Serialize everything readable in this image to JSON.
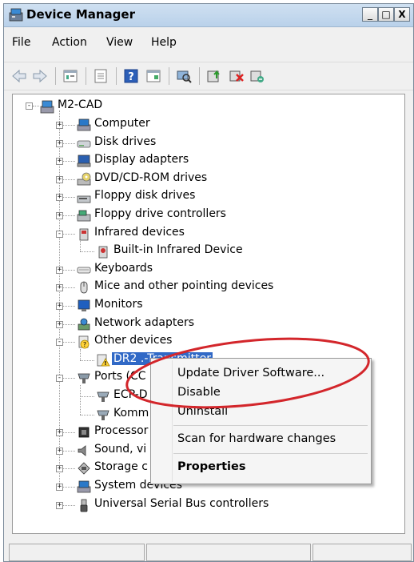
{
  "window": {
    "title": "Device Manager",
    "controls": {
      "minimize": "_",
      "maximize": "□",
      "close": "X"
    }
  },
  "menu": [
    "File",
    "Action",
    "View",
    "Help"
  ],
  "toolbar": {
    "icons": [
      "back-icon",
      "forward-icon",
      "tree-view-icon",
      "properties-icon",
      "help-icon",
      "action-view-icon",
      "scan-hardware-icon",
      "update-driver-icon",
      "disable-icon",
      "uninstall-icon"
    ]
  },
  "tree": {
    "root": "M2-CAD",
    "nodes": [
      {
        "label": "Computer",
        "icon": "computer-icon",
        "expander": "+"
      },
      {
        "label": "Disk drives",
        "icon": "disk-drive-icon",
        "expander": "+"
      },
      {
        "label": "Display adapters",
        "icon": "display-adapter-icon",
        "expander": "+"
      },
      {
        "label": "DVD/CD-ROM drives",
        "icon": "dvd-drive-icon",
        "expander": "+"
      },
      {
        "label": "Floppy disk drives",
        "icon": "floppy-drive-icon",
        "expander": "+"
      },
      {
        "label": "Floppy drive controllers",
        "icon": "floppy-controller-icon",
        "expander": "+"
      },
      {
        "label": "Infrared devices",
        "icon": "infrared-icon",
        "expander": "-"
      },
      {
        "label": "Built-in Infrared Device",
        "icon": "infrared-device-icon",
        "expander": ""
      },
      {
        "label": "Keyboards",
        "icon": "keyboard-icon",
        "expander": "+"
      },
      {
        "label": "Mice and other pointing devices",
        "icon": "mouse-icon",
        "expander": "+"
      },
      {
        "label": "Monitors",
        "icon": "monitor-icon",
        "expander": "+"
      },
      {
        "label": "Network adapters",
        "icon": "network-adapter-icon",
        "expander": "+"
      },
      {
        "label": "Other devices",
        "icon": "other-devices-icon",
        "expander": "-"
      },
      {
        "label": "DR2 .-Transmitter",
        "icon": "warning-device-icon",
        "expander": ""
      },
      {
        "label": "Ports (CC",
        "icon": "port-icon",
        "expander": "-"
      },
      {
        "label": "ECP-D",
        "icon": "port-device-icon",
        "expander": ""
      },
      {
        "label": "Komm",
        "icon": "port-device-icon",
        "expander": ""
      },
      {
        "label": "Processor",
        "icon": "processor-icon",
        "expander": "+"
      },
      {
        "label": "Sound, vi",
        "icon": "sound-icon",
        "expander": "+"
      },
      {
        "label": "Storage c",
        "icon": "storage-icon",
        "expander": "+"
      },
      {
        "label": "System devices",
        "icon": "system-devices-icon",
        "expander": "+"
      },
      {
        "label": "Universal Serial Bus controllers",
        "icon": "usb-icon",
        "expander": "+"
      }
    ]
  },
  "context_menu": {
    "items": [
      "Update Driver Software...",
      "Disable",
      "Uninstall",
      "Scan for hardware changes",
      "Properties"
    ],
    "bold_item": "Properties"
  },
  "colors": {
    "selection": "#3169c6",
    "annotation_ellipse": "#d3262b",
    "titlebar": "#b9d1ea"
  }
}
